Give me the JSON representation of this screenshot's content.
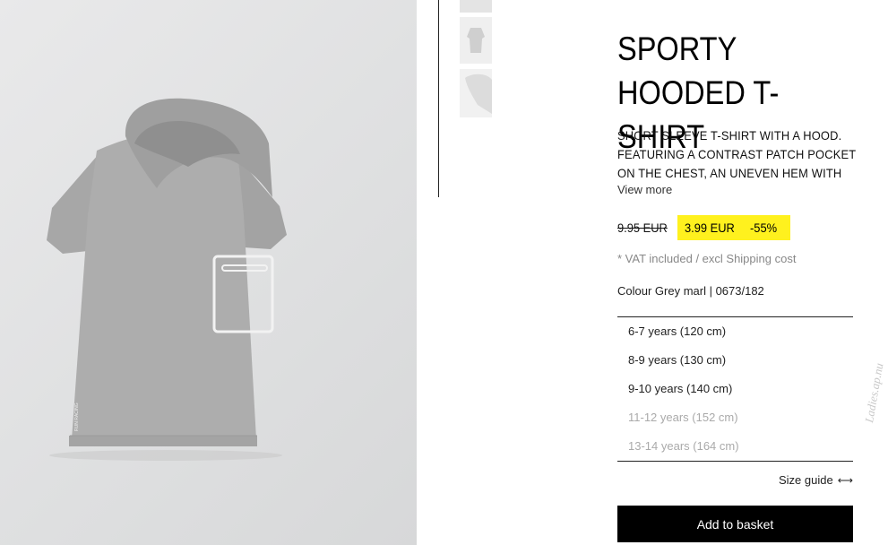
{
  "product": {
    "title_line1": "SPORTY",
    "title_line2": "HOODED T-SHIRT",
    "description_lines": [
      "SHORT SLEEVE T-SHIRT WITH A HOOD.",
      "FEATURING A CONTRAST PATCH POCKET",
      "ON THE CHEST, AN UNEVEN HEM WITH"
    ],
    "view_more": "View more",
    "old_price": "9.95 EUR",
    "new_price": "3.99 EUR",
    "discount": "-55%",
    "vat_note": "* VAT included / excl Shipping cost",
    "colour": "Colour Grey marl | 0673/182",
    "garment_print_text": "RUN RACING"
  },
  "sizes": [
    {
      "label": "6-7 years (120 cm)",
      "available": true
    },
    {
      "label": "8-9 years (130 cm)",
      "available": true
    },
    {
      "label": "9-10 years (140 cm)",
      "available": true
    },
    {
      "label": "11-12 years (152 cm)",
      "available": false
    },
    {
      "label": "13-14 years (164 cm)",
      "available": false
    }
  ],
  "actions": {
    "size_guide": "Size guide",
    "size_guide_icon": "⟷",
    "add_to_basket": "Add to basket"
  },
  "watermark": "Ladies.ap.nu",
  "colors": {
    "sale_highlight": "#fff11e",
    "button_bg": "#000000",
    "unavailable_text": "#aaaaaa"
  }
}
